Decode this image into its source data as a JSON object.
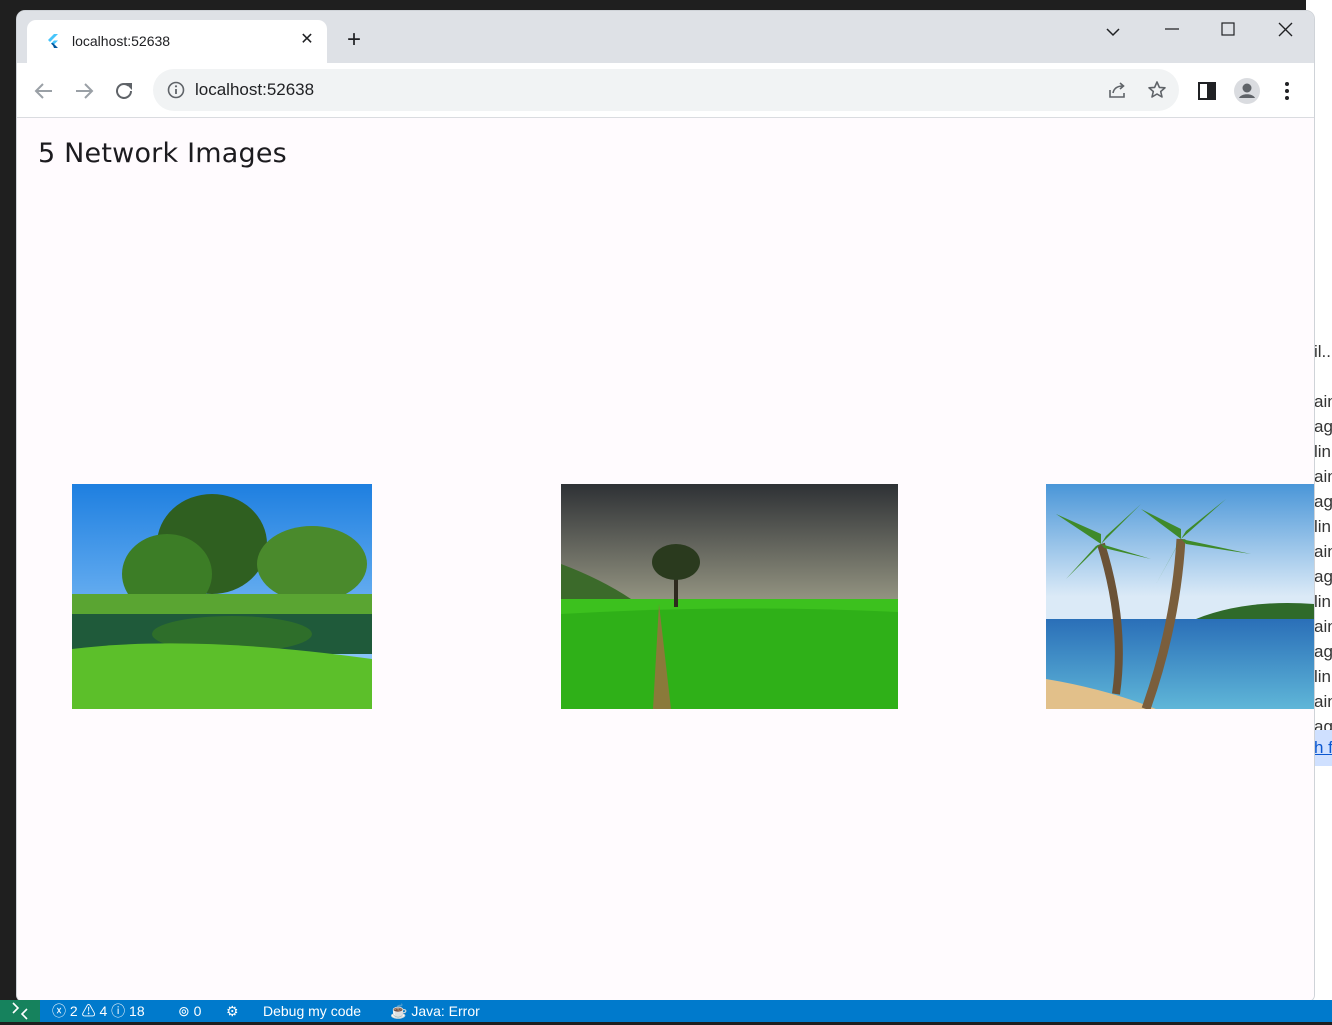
{
  "browser": {
    "tab": {
      "title": "localhost:52638",
      "close": "✕"
    },
    "new_tab": "+",
    "address": {
      "url": "localhost:52638"
    }
  },
  "page": {
    "heading": "5 Network Images",
    "images": [
      {
        "subject": "riverside-trees-landscape"
      },
      {
        "subject": "green-field-lone-tree"
      },
      {
        "subject": "palm-trees-beach"
      }
    ]
  },
  "editor_right_text": [
    "il..",
    "ain",
    "ag",
    "lin",
    "ain",
    "ag",
    "lin",
    "ain",
    "ag",
    "lin",
    "ain",
    "ag",
    "lin",
    "ain",
    "ag"
  ],
  "editor_right_link": "h f",
  "statusbar": {
    "errors": "2",
    "warnings": "4",
    "infos": "18",
    "ports": "0",
    "debug": "Debug my code",
    "java": "Java: Error"
  },
  "colors": {
    "page_bg": "#fffbfe",
    "tabstrip": "#dee1e6",
    "statusbar": "#007acc",
    "remote": "#16825d"
  }
}
